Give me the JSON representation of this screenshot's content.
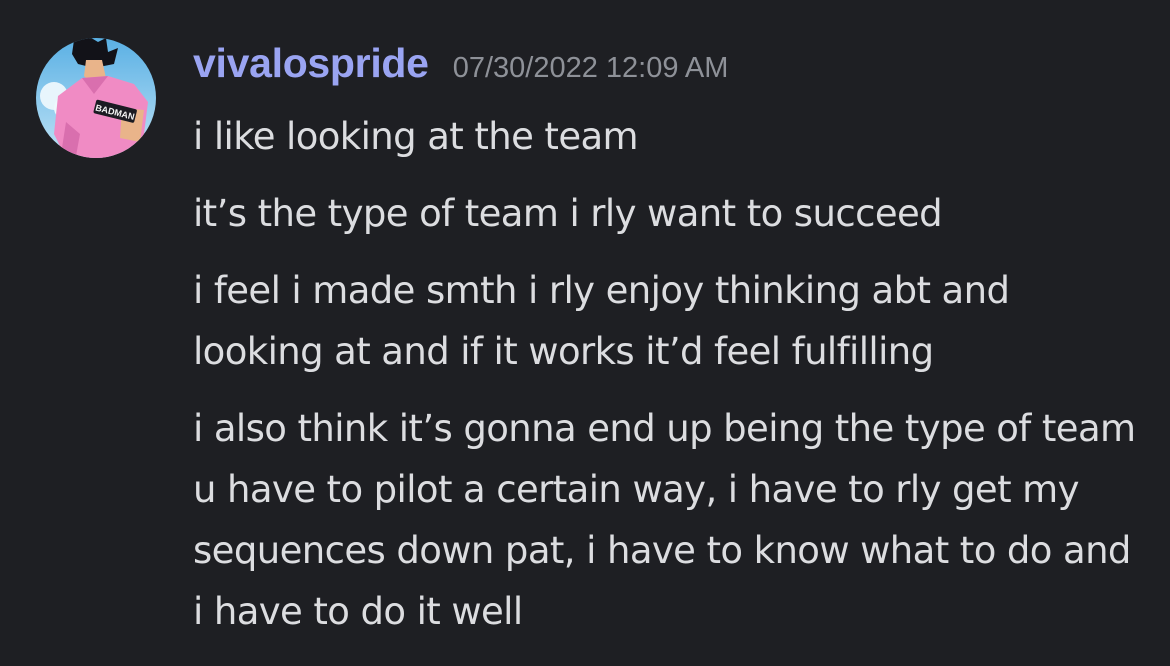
{
  "message": {
    "author": "vivalospride",
    "timestamp": "07/30/2022 12:09 AM",
    "avatar_text": "BADMAN",
    "lines": [
      "i like looking at the team",
      "it’s the type of team i rly want to succeed",
      "i feel i made smth i rly enjoy thinking abt and looking at and if it works it’d feel fulfilling",
      "i also think it’s gonna end up being the type of team u have to pilot a certain way, i have to rly get my sequences down pat, i have to know what to do and i have to do it well"
    ]
  },
  "colors": {
    "background": "#1e1f23",
    "username": "#9aa4f2",
    "timestamp": "#8e9198",
    "text": "#dcdde0"
  }
}
